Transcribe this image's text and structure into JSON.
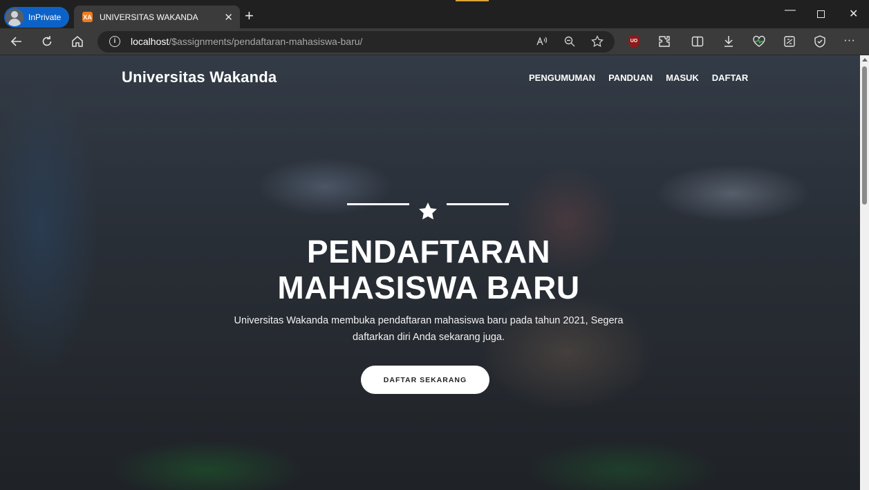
{
  "browser": {
    "profile_label": "InPrivate",
    "tab_title": "UNIVERSITAS WAKANDA",
    "favicon_text": "XA",
    "address_host": "localhost",
    "address_path": "/$assignments/pendaftaran-mahasiswa-baru/",
    "icons": [
      "back-icon",
      "refresh-icon",
      "home-icon",
      "info-icon",
      "read-aloud-icon",
      "zoom-icon",
      "favorite-icon",
      "ublock-icon",
      "extensions-icon",
      "split-screen-icon",
      "downloads-icon",
      "health-icon",
      "screenshot-icon",
      "security-icon",
      "more-icon"
    ],
    "ublock_label": "UO"
  },
  "site": {
    "brand": "Universitas Wakanda",
    "nav": [
      "PENGUMUMAN",
      "PANDUAN",
      "MASUK",
      "DAFTAR"
    ]
  },
  "hero": {
    "title_line1": "PENDAFTARAN",
    "title_line2": "MAHASISWA BARU",
    "subtitle_line1": "Universitas Wakanda membuka pendaftaran mahasiswa baru pada tahun 2021, Segera",
    "subtitle_line2": "daftarkan diri Anda sekarang juga.",
    "cta_label": "DAFTAR SEKARANG"
  }
}
